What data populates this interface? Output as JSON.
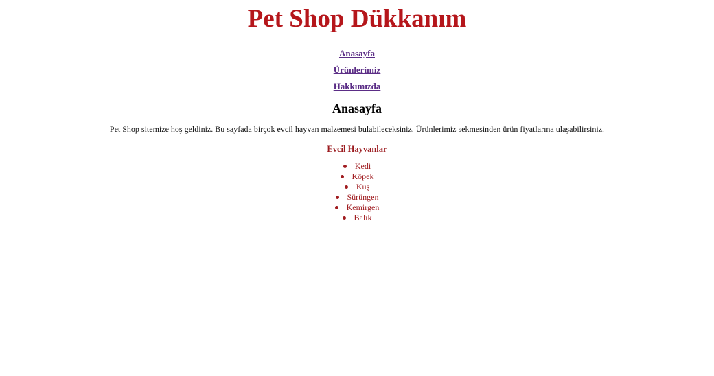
{
  "header": {
    "title": "Pet Shop Dükkanım"
  },
  "nav": {
    "items": [
      {
        "label": "Anasayfa"
      },
      {
        "label": "Ürünlerimiz"
      },
      {
        "label": "Hakkımızda"
      }
    ]
  },
  "main": {
    "section_title": "Anasayfa",
    "intro": "Pet Shop sitemize hoş geldiniz. Bu sayfada birçok evcil hayvan malzemesi bulabileceksiniz. Ürünlerimiz sekmesinden ürün fiyatlarına ulaşabilirsiniz.",
    "pets_heading": "Evcil Hayvanlar",
    "pets": [
      "Kedi",
      "Köpek",
      "Kuş",
      "Sürüngen",
      "Kemirgen",
      "Balık"
    ]
  },
  "colors": {
    "title": "#b5161b",
    "nav_link": "#5b2d86",
    "pets_text": "#a01c20"
  }
}
